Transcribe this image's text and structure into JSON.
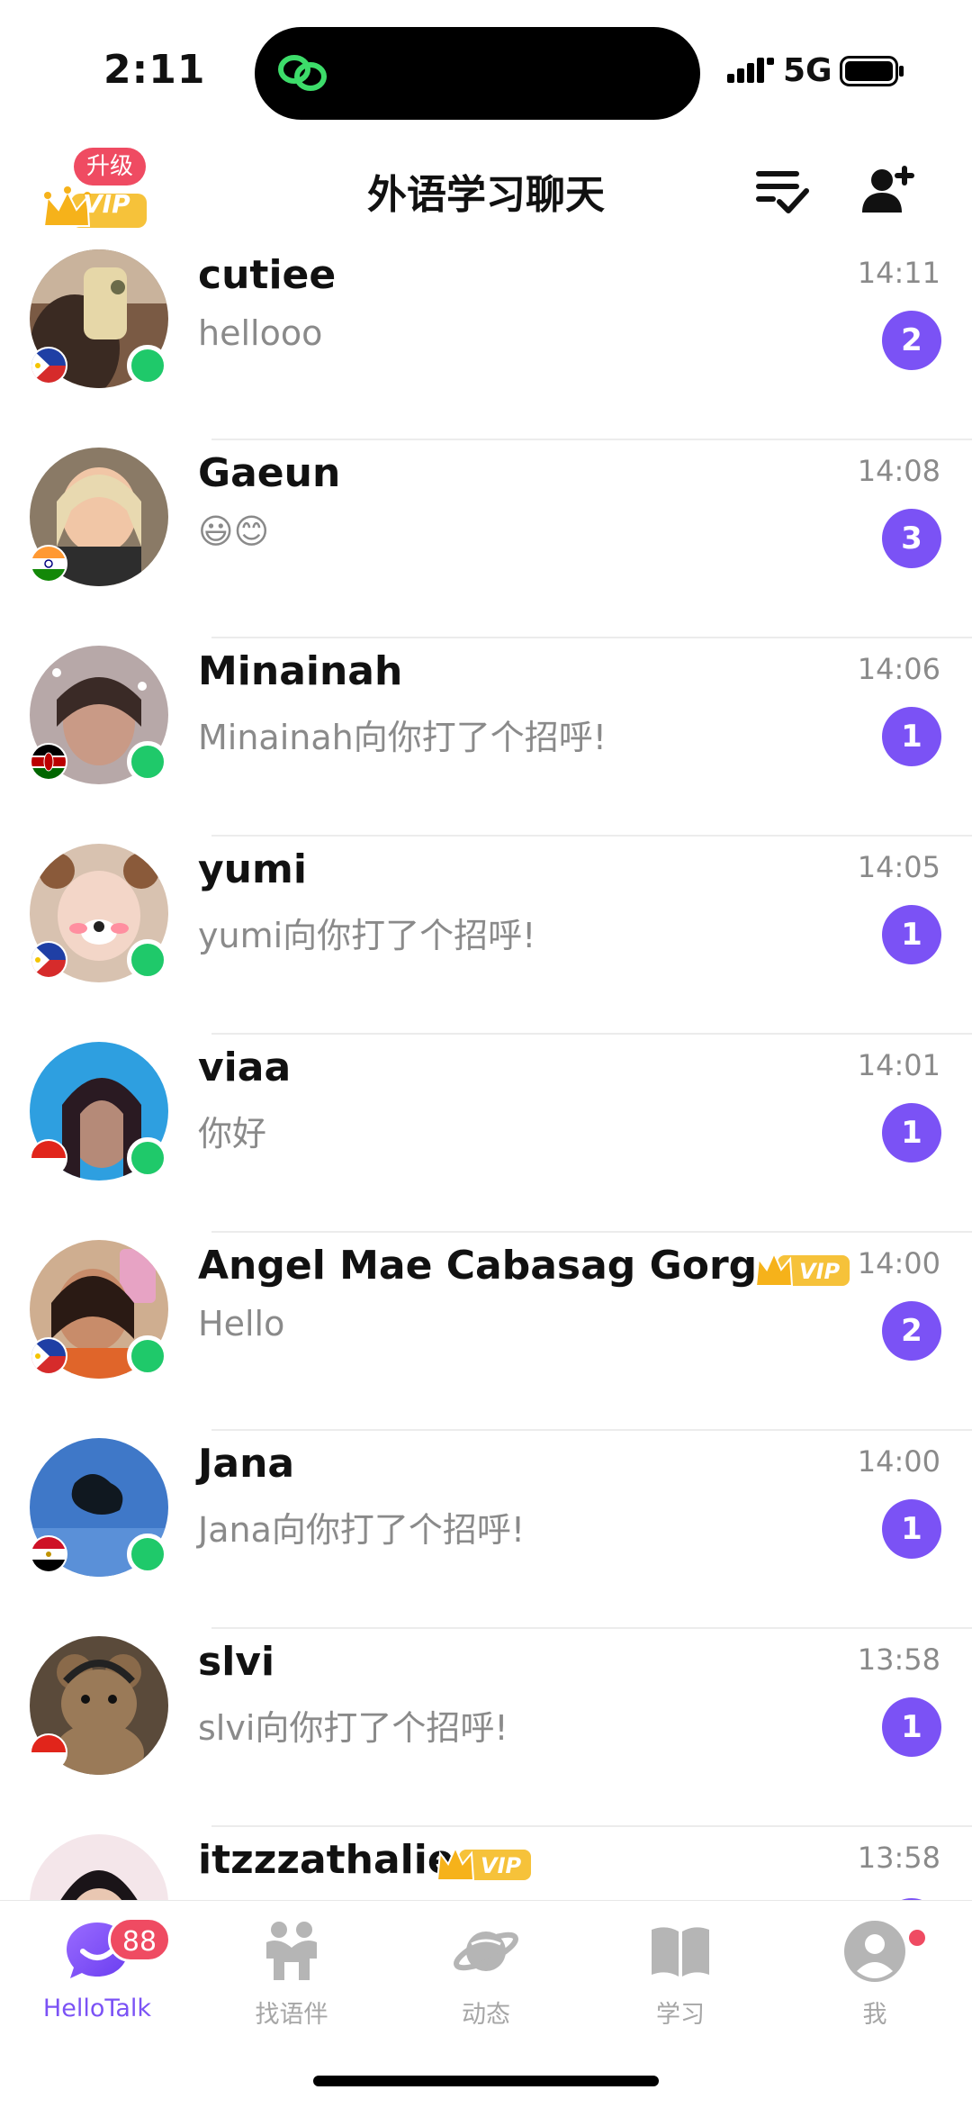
{
  "status_bar": {
    "time": "2:11",
    "network": "5G"
  },
  "header": {
    "title": "外语学习聊天",
    "upgrade_label": "升级",
    "vip_label": "VIP"
  },
  "colors": {
    "accent": "#7b52f5",
    "badge": "#ef4b62",
    "online": "#1fc96a",
    "vip_gold": "#f6c23a"
  },
  "chats": [
    {
      "name": "cutiee",
      "message": "hellooo",
      "time": "14:11",
      "unread": "2",
      "flag": "philippines",
      "online": true,
      "vip": false
    },
    {
      "name": "Gaeun",
      "message": "😃😊",
      "time": "14:08",
      "unread": "3",
      "flag": "india",
      "online": false,
      "vip": false
    },
    {
      "name": "Minainah",
      "message": "Minainah向你打了个招呼!",
      "time": "14:06",
      "unread": "1",
      "flag": "kenya",
      "online": true,
      "vip": false
    },
    {
      "name": "yumi",
      "message": "yumi向你打了个招呼!",
      "time": "14:05",
      "unread": "1",
      "flag": "philippines",
      "online": true,
      "vip": false
    },
    {
      "name": "viaa",
      "message": "你好",
      "time": "14:01",
      "unread": "1",
      "flag": "indonesia",
      "online": true,
      "vip": false
    },
    {
      "name": "Angel Mae Cabasag Gorg...",
      "message": "Hello",
      "time": "14:00",
      "unread": "2",
      "flag": "philippines",
      "online": true,
      "vip": true,
      "vip_label": "VIP"
    },
    {
      "name": "Jana",
      "message": "Jana向你打了个招呼!",
      "time": "14:00",
      "unread": "1",
      "flag": "egypt",
      "online": true,
      "vip": false
    },
    {
      "name": "slvi",
      "message": "slvi向你打了个招呼!",
      "time": "13:58",
      "unread": "1",
      "flag": "indonesia",
      "online": false,
      "vip": false
    },
    {
      "name": "itzzzathalie",
      "message": "",
      "time": "13:58",
      "unread": "",
      "flag": "",
      "online": false,
      "vip": true,
      "vip_label": "VIP"
    }
  ],
  "tabs": [
    {
      "label": "HelloTalk",
      "icon": "chat-bubble-icon",
      "badge": "88",
      "active": true
    },
    {
      "label": "找语伴",
      "icon": "partners-icon",
      "active": false
    },
    {
      "label": "动态",
      "icon": "planet-icon",
      "active": false
    },
    {
      "label": "学习",
      "icon": "book-icon",
      "active": false
    },
    {
      "label": "我",
      "icon": "profile-icon",
      "dot": true,
      "active": false
    }
  ]
}
